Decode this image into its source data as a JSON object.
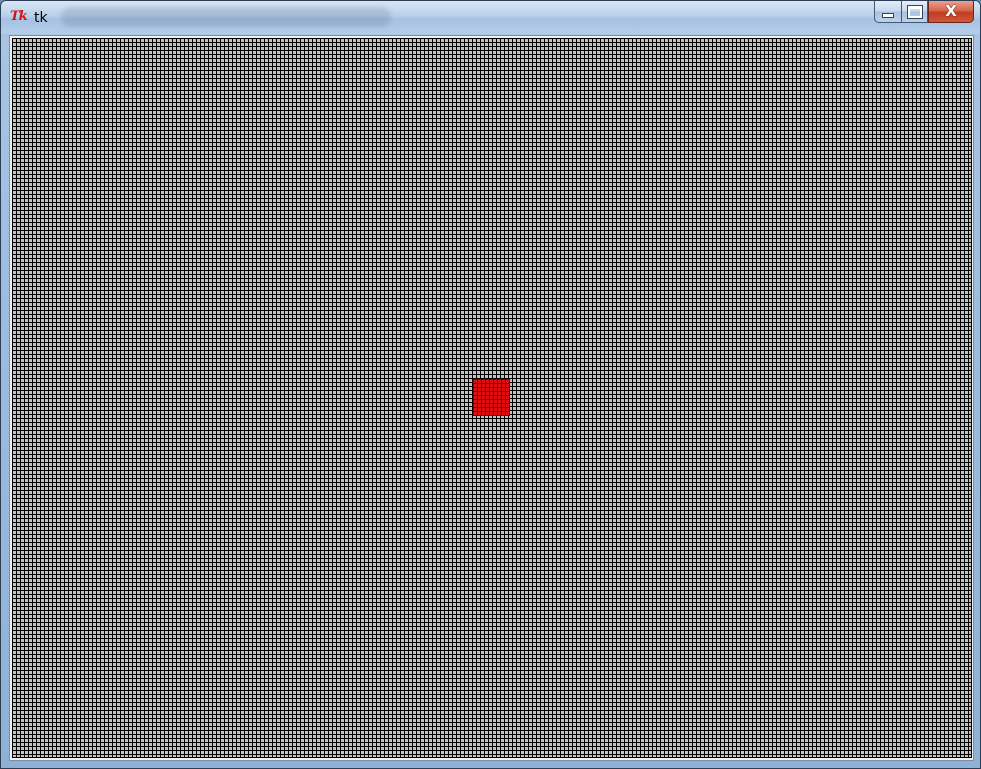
{
  "window": {
    "title": "tk",
    "app_icon_text": "Tk",
    "controls": {
      "minimize_icon": "minimize-icon",
      "maximize_icon": "maximize-icon",
      "close_icon": "close-icon",
      "close_glyph": "X"
    }
  },
  "canvas": {
    "background_color": "#c4c4c4",
    "grid_line_color": "#000000",
    "highlight_color": "#e01010"
  }
}
